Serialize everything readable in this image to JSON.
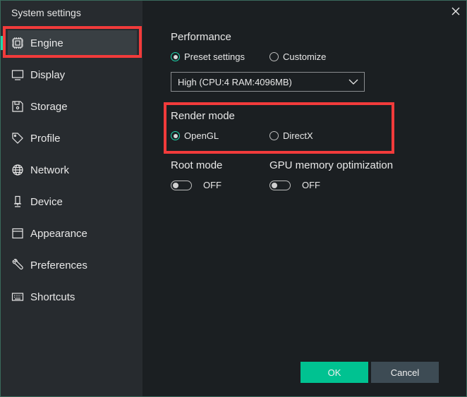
{
  "window": {
    "title": "System settings",
    "close_icon": "close-icon"
  },
  "sidebar": {
    "items": [
      {
        "label": "Engine",
        "icon": "chip-icon",
        "active": true
      },
      {
        "label": "Display",
        "icon": "monitor-icon"
      },
      {
        "label": "Storage",
        "icon": "floppy-disk-icon"
      },
      {
        "label": "Profile",
        "icon": "tag-icon"
      },
      {
        "label": "Network",
        "icon": "globe-icon"
      },
      {
        "label": "Device",
        "icon": "device-icon"
      },
      {
        "label": "Appearance",
        "icon": "window-icon"
      },
      {
        "label": "Preferences",
        "icon": "wrench-icon"
      },
      {
        "label": "Shortcuts",
        "icon": "keyboard-icon"
      }
    ]
  },
  "performance": {
    "label": "Performance",
    "options": [
      {
        "label": "Preset settings",
        "checked": true
      },
      {
        "label": "Customize",
        "checked": false
      }
    ],
    "preset_select": {
      "value": "High (CPU:4 RAM:4096MB)"
    }
  },
  "render_mode": {
    "label": "Render mode",
    "options": [
      {
        "label": "OpenGL",
        "checked": true
      },
      {
        "label": "DirectX",
        "checked": false
      }
    ]
  },
  "root_mode": {
    "label": "Root mode",
    "state": "OFF"
  },
  "gpu_memory": {
    "label": "GPU memory optimization",
    "state": "OFF"
  },
  "buttons": {
    "ok": "OK",
    "cancel": "Cancel"
  },
  "colors": {
    "accent": "#00c291",
    "highlight_box": "#f23b3b",
    "sidebar_bg": "#272b2f",
    "content_bg": "#1b1f22"
  }
}
